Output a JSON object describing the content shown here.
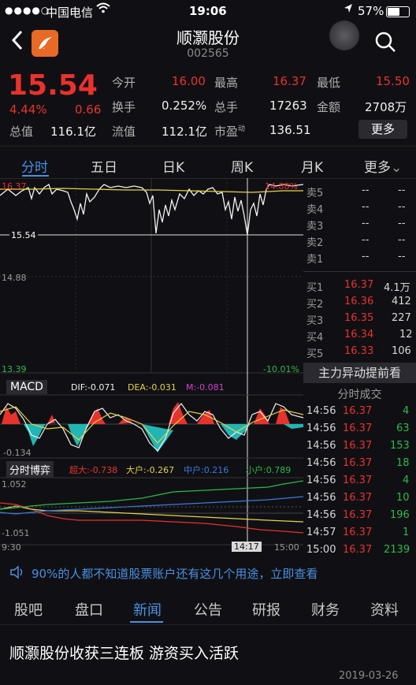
{
  "status": {
    "signal": "●●●●○",
    "carrier": "中国电信",
    "time": "19:06",
    "battery": "57%"
  },
  "header": {
    "title": "顺灏股份",
    "code": "002565"
  },
  "quote": {
    "price": "15.54",
    "pct": "4.44%",
    "chg": "0.66",
    "fields": [
      {
        "label": "今开",
        "value": "16.00",
        "color": "red"
      },
      {
        "label": "最高",
        "value": "16.37",
        "color": "red"
      },
      {
        "label": "最低",
        "value": "15.50",
        "color": "red"
      },
      {
        "label": "换手",
        "value": "0.252%",
        "color": "white"
      },
      {
        "label": "总手",
        "value": "17263",
        "color": "white"
      },
      {
        "label": "金额",
        "value": "2708万",
        "color": "white"
      },
      {
        "label": "总值",
        "value": "116.1亿",
        "color": "white"
      },
      {
        "label": "流值",
        "value": "112.1亿",
        "color": "white"
      },
      {
        "label": "市盈",
        "sup": "动",
        "value": "136.51",
        "color": "white"
      }
    ],
    "more_label": "更多"
  },
  "tabs": [
    "分时",
    "五日",
    "日K",
    "周K",
    "月K",
    "更多"
  ],
  "chart": {
    "price_top": "16.37",
    "pct_top": "14.88%",
    "cursor_price": "15.54",
    "mid_price": "14.88",
    "price_bottom": "13.39",
    "pct_bottom": "-10.01%",
    "macd": {
      "label": "MACD",
      "dif": "DIF:-0.071",
      "dea": "DEA:-0.031",
      "m": "M:-0.081",
      "low": "-0.134"
    },
    "game": {
      "label": "分时博弈",
      "super": "超大:-0.738",
      "large": "大户:-0.267",
      "mid": "中户:0.216",
      "small": "小户:0.789",
      "top": "1.052",
      "bottom": "-1.051"
    },
    "time_start": "9:30",
    "time_cursor": "14:17",
    "time_end": "15:00"
  },
  "orderbook": {
    "asks": [
      {
        "label": "卖5",
        "price": "--",
        "vol": "--"
      },
      {
        "label": "卖4",
        "price": "--",
        "vol": "--"
      },
      {
        "label": "卖3",
        "price": "--",
        "vol": "--"
      },
      {
        "label": "卖2",
        "price": "--",
        "vol": "--"
      },
      {
        "label": "卖1",
        "price": "--",
        "vol": "--"
      }
    ],
    "bids": [
      {
        "label": "买1",
        "price": "16.37",
        "vol": "4.1万"
      },
      {
        "label": "买2",
        "price": "16.36",
        "vol": "412"
      },
      {
        "label": "买3",
        "price": "16.35",
        "vol": "227"
      },
      {
        "label": "买4",
        "price": "16.34",
        "vol": "12"
      },
      {
        "label": "买5",
        "price": "16.33",
        "vol": "106"
      }
    ],
    "alert_label": "主力异动提前看",
    "ticks_title": "分时成交",
    "ticks": [
      {
        "t": "14:56",
        "p": "16.37",
        "v": "4"
      },
      {
        "t": "14:56",
        "p": "16.37",
        "v": "63"
      },
      {
        "t": "14:56",
        "p": "16.37",
        "v": "153"
      },
      {
        "t": "14:56",
        "p": "16.37",
        "v": "18"
      },
      {
        "t": "14:56",
        "p": "16.37",
        "v": "4"
      },
      {
        "t": "14:56",
        "p": "16.37",
        "v": "10"
      },
      {
        "t": "14:56",
        "p": "16.37",
        "v": "196"
      },
      {
        "t": "14:57",
        "p": "16.37",
        "v": "1"
      },
      {
        "t": "15:00",
        "p": "16.37",
        "v": "2139"
      }
    ]
  },
  "ad": "90%的人都不知道股票账户还有这几个用途，立即查看",
  "bottom_tabs": [
    "股吧",
    "盘口",
    "新闻",
    "公告",
    "研报",
    "财务",
    "资料"
  ],
  "news": {
    "title": "顺灏股份收获三连板 游资买入活跃",
    "date": "2019-03-26"
  },
  "colors": {
    "red": "#e8322c",
    "green": "#2db84a",
    "accent": "#4a90e2",
    "bg": "#101014"
  }
}
